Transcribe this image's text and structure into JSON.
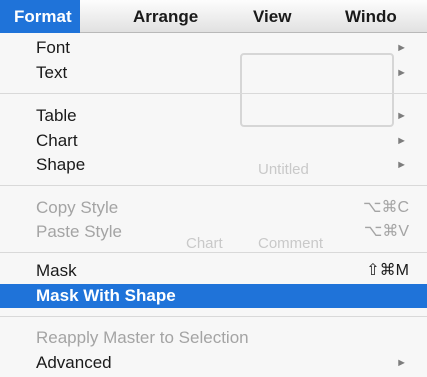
{
  "menubar": {
    "items": [
      "Format",
      "Arrange",
      "View",
      "Windo"
    ]
  },
  "menu": {
    "items": [
      {
        "label": "Font",
        "submenu": true
      },
      {
        "label": "Text",
        "submenu": true
      },
      {
        "label": "Table",
        "submenu": true
      },
      {
        "label": "Chart",
        "submenu": true
      },
      {
        "label": "Shape",
        "submenu": true
      },
      {
        "label": "Copy Style",
        "shortcut": "⌥⌘C",
        "disabled": true
      },
      {
        "label": "Paste Style",
        "shortcut": "⌥⌘V",
        "disabled": true
      },
      {
        "label": "Mask",
        "shortcut": "⇧⌘M"
      },
      {
        "label": "Mask With Shape",
        "highlighted": true
      },
      {
        "label": "Reapply Master to Selection",
        "disabled": true
      },
      {
        "label": "Advanced",
        "submenu": true
      }
    ],
    "submenu_arrow": "►"
  },
  "background": {
    "window_title": "Untitled",
    "toolbar_labels": [
      "Chart",
      "Comment"
    ]
  },
  "colors": {
    "highlight": "#1f73d9"
  }
}
